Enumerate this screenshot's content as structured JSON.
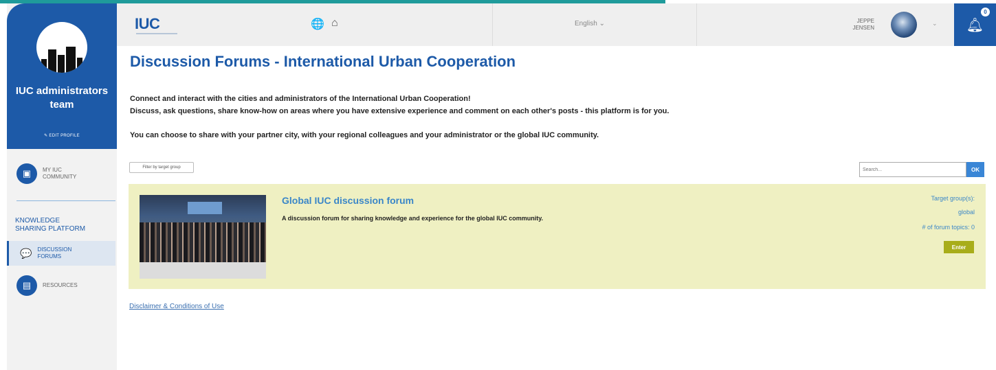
{
  "sidebar": {
    "team_name": "IUC administrators team",
    "edit_profile": "EDIT PROFILE",
    "my_community": "MY IUC COMMUNITY",
    "section_title_1": "KNOWLEDGE",
    "section_title_2": "SHARING PLATFORM",
    "discussion_forums": "DISCUSSION FORUMS",
    "resources": "RESOURCES"
  },
  "header": {
    "logo": "IUC",
    "language": "English",
    "user_first": "JEPPE",
    "user_last": "JENSEN",
    "notification_count": "0"
  },
  "main": {
    "title": "Discussion Forums - International Urban Cooperation",
    "intro_line_1": "Connect and interact with the cities and administrators of the International Urban Cooperation!",
    "intro_line_2": "Discuss, ask questions, share know-how on areas where you have extensive experience and comment on each other's posts - this platform is for you.",
    "intro_line_3": "You can choose to share with your partner city, with your regional colleagues and your administrator or the global IUC community.",
    "filter_label": "Filter by target group",
    "search_placeholder": "Search...",
    "search_button": "OK",
    "forum": {
      "title": "Global IUC discussion forum",
      "description": "A discussion forum for sharing knowledge and experience for the global IUC community.",
      "target_label": "Target group(s):",
      "target_value": "global",
      "topics_label": "# of forum topics: 0",
      "enter_label": "Enter"
    },
    "disclaimer": "Disclaimer & Conditions of Use"
  },
  "colors": {
    "brand_blue": "#1d5aa8",
    "accent_teal": "#1f9b9b",
    "forum_card_bg": "#eff0c2",
    "enter_button": "#a8ad1a"
  },
  "icons": [
    "globe-icon",
    "home-icon",
    "bell-icon",
    "edit-icon",
    "community-icon",
    "discussion-icon",
    "resources-icon",
    "chevron-down-icon"
  ]
}
